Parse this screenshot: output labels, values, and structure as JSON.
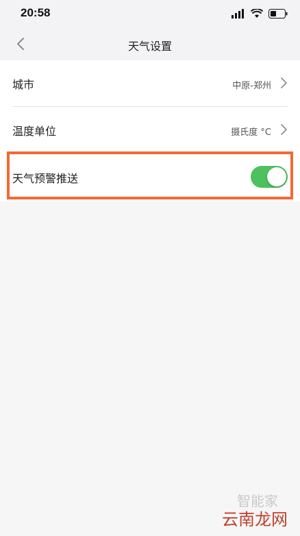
{
  "status_bar": {
    "time": "20:58",
    "icons": [
      "signal-icon",
      "wifi-icon",
      "battery-icon"
    ]
  },
  "nav": {
    "title": "天气设置",
    "back_icon": "chevron-left-icon"
  },
  "settings": {
    "city": {
      "label": "城市",
      "value": "中原-郑州"
    },
    "temperature_unit": {
      "label": "温度单位",
      "value": "摄氏度 °C"
    },
    "weather_alert_push": {
      "label": "天气预警推送",
      "enabled": true
    }
  },
  "colors": {
    "toggle_on": "#4cc15d",
    "highlight_border": "#f26a35",
    "background": "#f6f6f7"
  },
  "watermark": {
    "top_text": "智能家",
    "bottom_text": "云南龙网"
  }
}
